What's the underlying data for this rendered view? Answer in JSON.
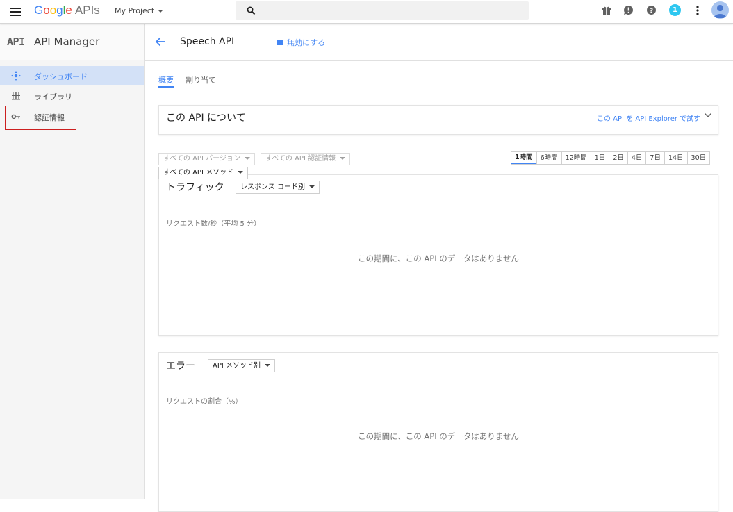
{
  "topbar": {
    "logo": {
      "letters": [
        "G",
        "o",
        "o",
        "g",
        "l",
        "e"
      ],
      "apis": "APIs"
    },
    "project": "My Project",
    "search": {
      "placeholder": ""
    },
    "notification_count": "1"
  },
  "sidebar": {
    "logo_text": "API",
    "title": "API Manager",
    "items": [
      {
        "label": "ダッシュボード",
        "icon": "dashboard-icon",
        "active": true
      },
      {
        "label": "ライブラリ",
        "icon": "library-icon",
        "active": false
      },
      {
        "label": "認証情報",
        "icon": "key-icon",
        "active": false
      }
    ]
  },
  "header": {
    "title": "Speech API",
    "disable_label": "無効にする"
  },
  "tabs": [
    {
      "label": "概要",
      "active": true
    },
    {
      "label": "割り当て",
      "active": false
    }
  ],
  "about": {
    "title": "この API について",
    "explorer_link": "この API を API Explorer で試す"
  },
  "filters": {
    "version": "すべての API バージョン",
    "credentials": "すべての API 認証情報",
    "method": "すべての API メソッド"
  },
  "time_ranges": {
    "options": [
      "1時間",
      "6時間",
      "12時間",
      "1日",
      "2日",
      "4日",
      "7日",
      "14日",
      "30日"
    ],
    "selected": "1時間"
  },
  "traffic": {
    "title": "トラフィック",
    "dropdown": "レスポンス コード別",
    "ylabel": "リクエスト数/秒（平均 5 分）",
    "no_data": "この期間に、この API のデータはありません"
  },
  "errors": {
    "title": "エラー",
    "dropdown": "API メソッド別",
    "ylabel": "リクエストの割合（%）",
    "no_data": "この期間に、この API のデータはありません"
  },
  "colors": {
    "accent": "#4285f4",
    "active_nav_bg": "#d3e1f7",
    "highlight_border": "#cc1f1f",
    "badge": "#2ec7f0"
  }
}
